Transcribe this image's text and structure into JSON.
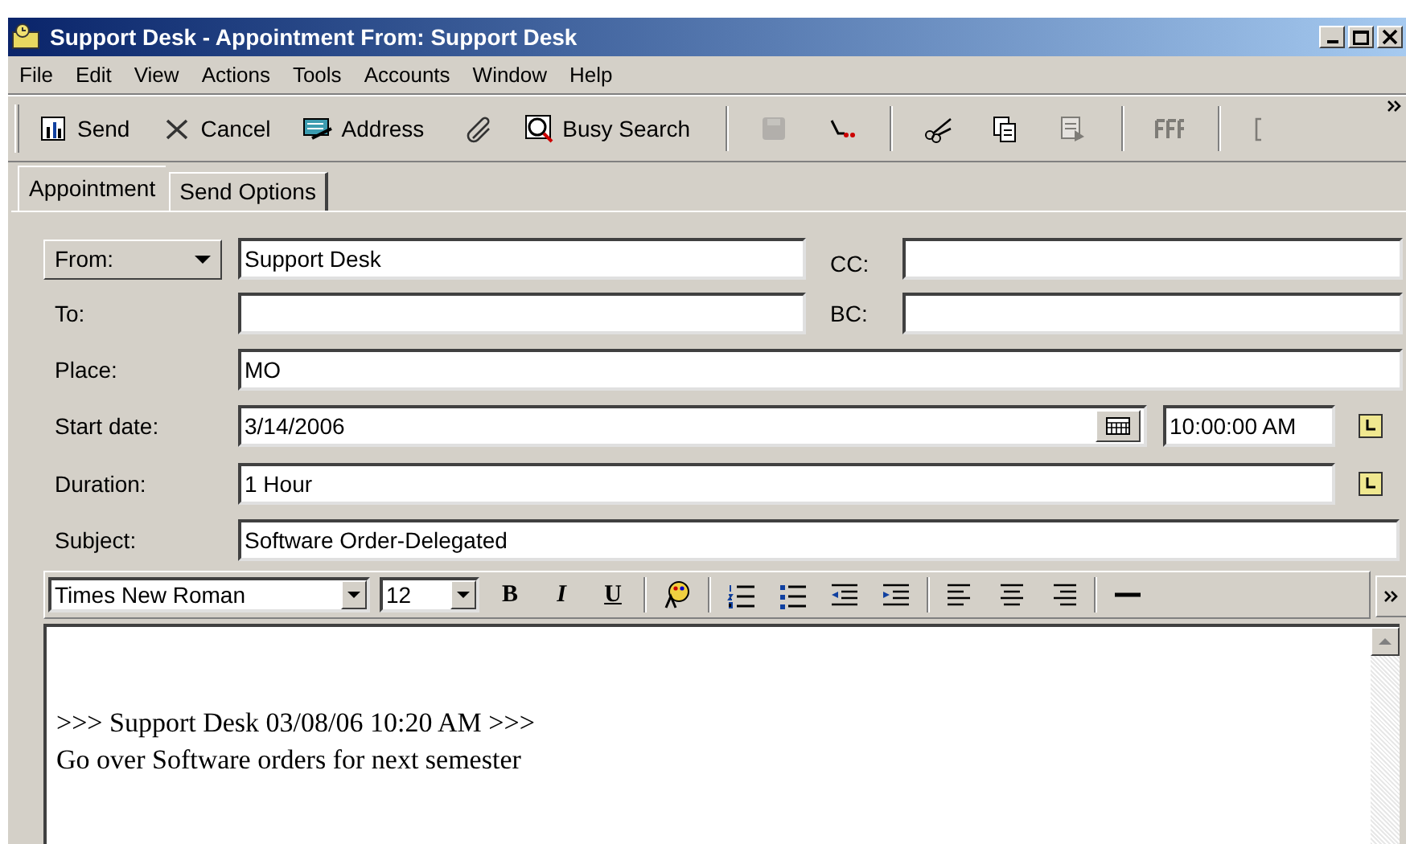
{
  "window": {
    "title": "Support Desk - Appointment From: Support Desk"
  },
  "menu": [
    "File",
    "Edit",
    "View",
    "Actions",
    "Tools",
    "Accounts",
    "Window",
    "Help"
  ],
  "toolbar": [
    {
      "kind": "button",
      "label": "Send",
      "disabled": false
    },
    {
      "kind": "button",
      "label": "Cancel",
      "disabled": false
    },
    {
      "kind": "button",
      "label": "Address",
      "disabled": false
    },
    {
      "kind": "icon",
      "disabled": false
    },
    {
      "kind": "button",
      "label": "Busy Search",
      "disabled": false
    },
    {
      "kind": "separator"
    },
    {
      "kind": "icon",
      "disabled": true
    },
    {
      "kind": "icon",
      "disabled": false
    },
    {
      "kind": "separator"
    },
    {
      "kind": "icon",
      "disabled": false
    },
    {
      "kind": "icon",
      "disabled": false
    },
    {
      "kind": "icon",
      "disabled": true
    },
    {
      "kind": "separator"
    },
    {
      "kind": "icon",
      "disabled": true
    },
    {
      "kind": "separator"
    },
    {
      "kind": "icon",
      "disabled": true
    }
  ],
  "tabs": [
    {
      "label": "Appointment",
      "selected": true
    },
    {
      "label": "Send Options",
      "selected": false
    }
  ],
  "form": {
    "from": {
      "label": "From:",
      "value": "Support Desk"
    },
    "cc": {
      "label": "CC:"
    },
    "to": {
      "label": "To:"
    },
    "bc": {
      "label": "BC:"
    },
    "place": {
      "label": "Place:",
      "value": "MO"
    },
    "start_date": {
      "label": "Start date:",
      "value": "3/14/2006",
      "time": "10:00:00 AM"
    },
    "duration": {
      "label": "Duration:",
      "value": "1 Hour"
    },
    "subject": {
      "label": "Subject:",
      "value": "Software Order-Delegated"
    }
  },
  "format_bar": {
    "font": "Times New Roman",
    "size": "12",
    "bold": "B",
    "italic": "I",
    "underline": "U"
  },
  "message": [
    ">>> Support Desk 03/08/06 10:20 AM >>>",
    "Go over Software orders for next semester"
  ]
}
